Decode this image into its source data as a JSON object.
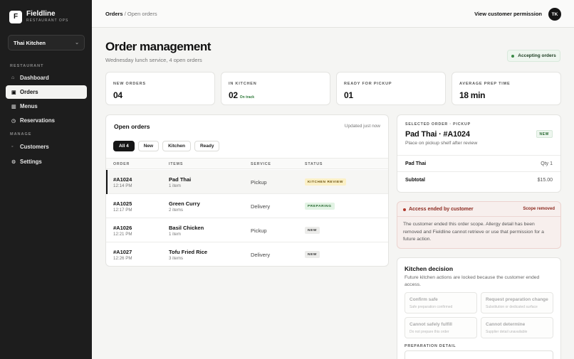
{
  "brand": {
    "logo_letter": "F",
    "name": "Fieldline",
    "tagline": "RESTAURANT OPS"
  },
  "location": {
    "selected": "Thai Kitchen"
  },
  "sidebar": {
    "section_restaurant": "RESTAURANT",
    "section_manage": "MANAGE",
    "items": [
      {
        "label": "Dashboard",
        "icon": "home-icon",
        "active": false
      },
      {
        "label": "Orders",
        "icon": "orders-icon",
        "active": true
      },
      {
        "label": "Menus",
        "icon": "menu-book-icon",
        "active": false
      },
      {
        "label": "Reservations",
        "icon": "clock-icon",
        "active": false
      },
      {
        "label": "Customers",
        "icon": "users-icon",
        "active": false
      },
      {
        "label": "Settings",
        "icon": "gear-icon",
        "active": false
      }
    ]
  },
  "topbar": {
    "breadcrumb_root": "Orders",
    "breadcrumb_sep": "/",
    "breadcrumb_current": "Open orders",
    "permission_button": "View customer permission",
    "avatar_initials": "TK"
  },
  "header": {
    "title": "Order management",
    "subtitle": "Wednesday lunch service, 4 open orders",
    "status_pill": "Accepting orders"
  },
  "stats": [
    {
      "label": "NEW ORDERS",
      "value": "04",
      "note": ""
    },
    {
      "label": "IN KITCHEN",
      "value": "02",
      "note": "On track"
    },
    {
      "label": "READY FOR PICKUP",
      "value": "01",
      "note": ""
    },
    {
      "label": "AVERAGE PREP TIME",
      "value": "18 min",
      "note": ""
    }
  ],
  "orders_panel": {
    "title": "Open orders",
    "updated": "Updated just now",
    "filters": [
      "All 4",
      "New",
      "Kitchen",
      "Ready"
    ],
    "columns": [
      "ORDER",
      "ITEMS",
      "SERVICE",
      "STATUS"
    ],
    "rows": [
      {
        "id": "#A1024",
        "time": "12:14 PM",
        "item": "Pad Thai",
        "qty": "1 item",
        "service": "Pickup",
        "status": "KITCHEN REVIEW"
      },
      {
        "id": "#A1025",
        "time": "12:17 PM",
        "item": "Green Curry",
        "qty": "2 items",
        "service": "Delivery",
        "status": "PREPARING"
      },
      {
        "id": "#A1026",
        "time": "12:21 PM",
        "item": "Basil Chicken",
        "qty": "1 item",
        "service": "Pickup",
        "status": "NEW"
      },
      {
        "id": "#A1027",
        "time": "12:26 PM",
        "item": "Tofu Fried Rice",
        "qty": "3 items",
        "service": "Delivery",
        "status": "NEW"
      }
    ]
  },
  "selected_order": {
    "label": "SELECTED ORDER · PICKUP",
    "title": "Pad Thai · #A1024",
    "badge": "NEW",
    "note": "Place on pickup shelf after review",
    "line_item": "Pad Thai",
    "line_qty": "Qty 1",
    "subtotal_label": "Subtotal",
    "subtotal_value": "$15.00"
  },
  "access_alert": {
    "title": "Access ended by customer",
    "scope": "Scope removed",
    "body": "The customer ended this order scope. Allergy detail has been removed and Fieldline cannot retrieve or use that permission for a future action."
  },
  "kitchen_decision": {
    "title": "Kitchen decision",
    "description": "Future kitchen actions are locked because the customer ended access.",
    "options": [
      {
        "title": "Confirm safe",
        "sub": "Safe preparation confirmed"
      },
      {
        "title": "Request preparation change",
        "sub": "Substitution or dedicated surface"
      },
      {
        "title": "Cannot safely fulfill",
        "sub": "Do not prepare this order"
      },
      {
        "title": "Cannot determine",
        "sub": "Supplier detail unavailable"
      }
    ],
    "prep_label": "PREPARATION DETAIL"
  }
}
